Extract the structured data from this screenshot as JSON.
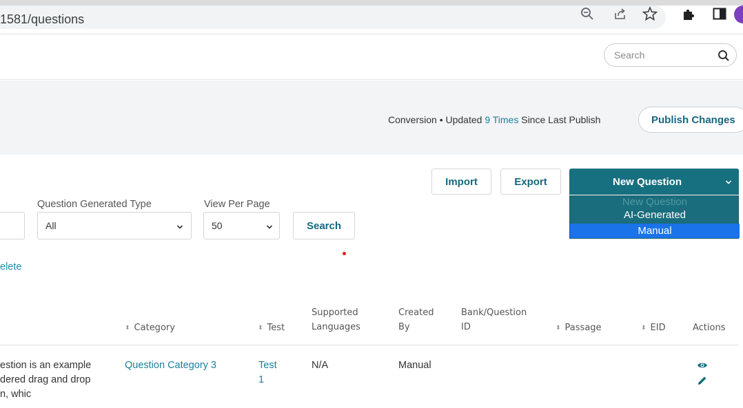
{
  "browser": {
    "url": "1581/questions",
    "icons": [
      "zoom-icon",
      "share-icon",
      "star-icon",
      "extensions-icon",
      "sidepanel-icon",
      "profile-avatar"
    ]
  },
  "header": {
    "search_placeholder": "Search"
  },
  "status": {
    "prefix": "Conversion • Updated ",
    "count_link": "9 Times",
    "suffix": " Since Last Publish",
    "publish_label": "Publish Changes"
  },
  "actions": {
    "import_label": "Import",
    "export_label": "Export",
    "new_question_label": "New Question"
  },
  "new_question_menu": {
    "options": [
      "New Question",
      "AI-Generated",
      "Manual"
    ],
    "highlighted": "Manual"
  },
  "filters": {
    "generated_type_label": "Question Generated Type",
    "generated_type_value": "All",
    "per_page_label": "View Per Page",
    "per_page_value": "50",
    "search_label": "Search",
    "delete_link": "elete"
  },
  "table": {
    "columns": {
      "category": "Category",
      "test": "Test",
      "languages_1": "Supported",
      "languages_2": "Languages",
      "created_1": "Created",
      "created_2": "By",
      "bank_1": "Bank/Question",
      "bank_2": "ID",
      "passage": "Passage",
      "eid": "EID",
      "actions": "Actions"
    },
    "rows": [
      {
        "question_line1": "estion is an example",
        "question_line2": "dered drag and drop",
        "question_line3": "n, whic",
        "category": "Question Category 3",
        "test_1": "Test",
        "test_2": "1",
        "languages": "N/A",
        "created_by": "Manual",
        "bank_id": "",
        "passage": "",
        "eid": ""
      }
    ]
  },
  "colors": {
    "accent": "#17707f",
    "link": "#1a7f9c",
    "highlight": "#1a73e8"
  }
}
